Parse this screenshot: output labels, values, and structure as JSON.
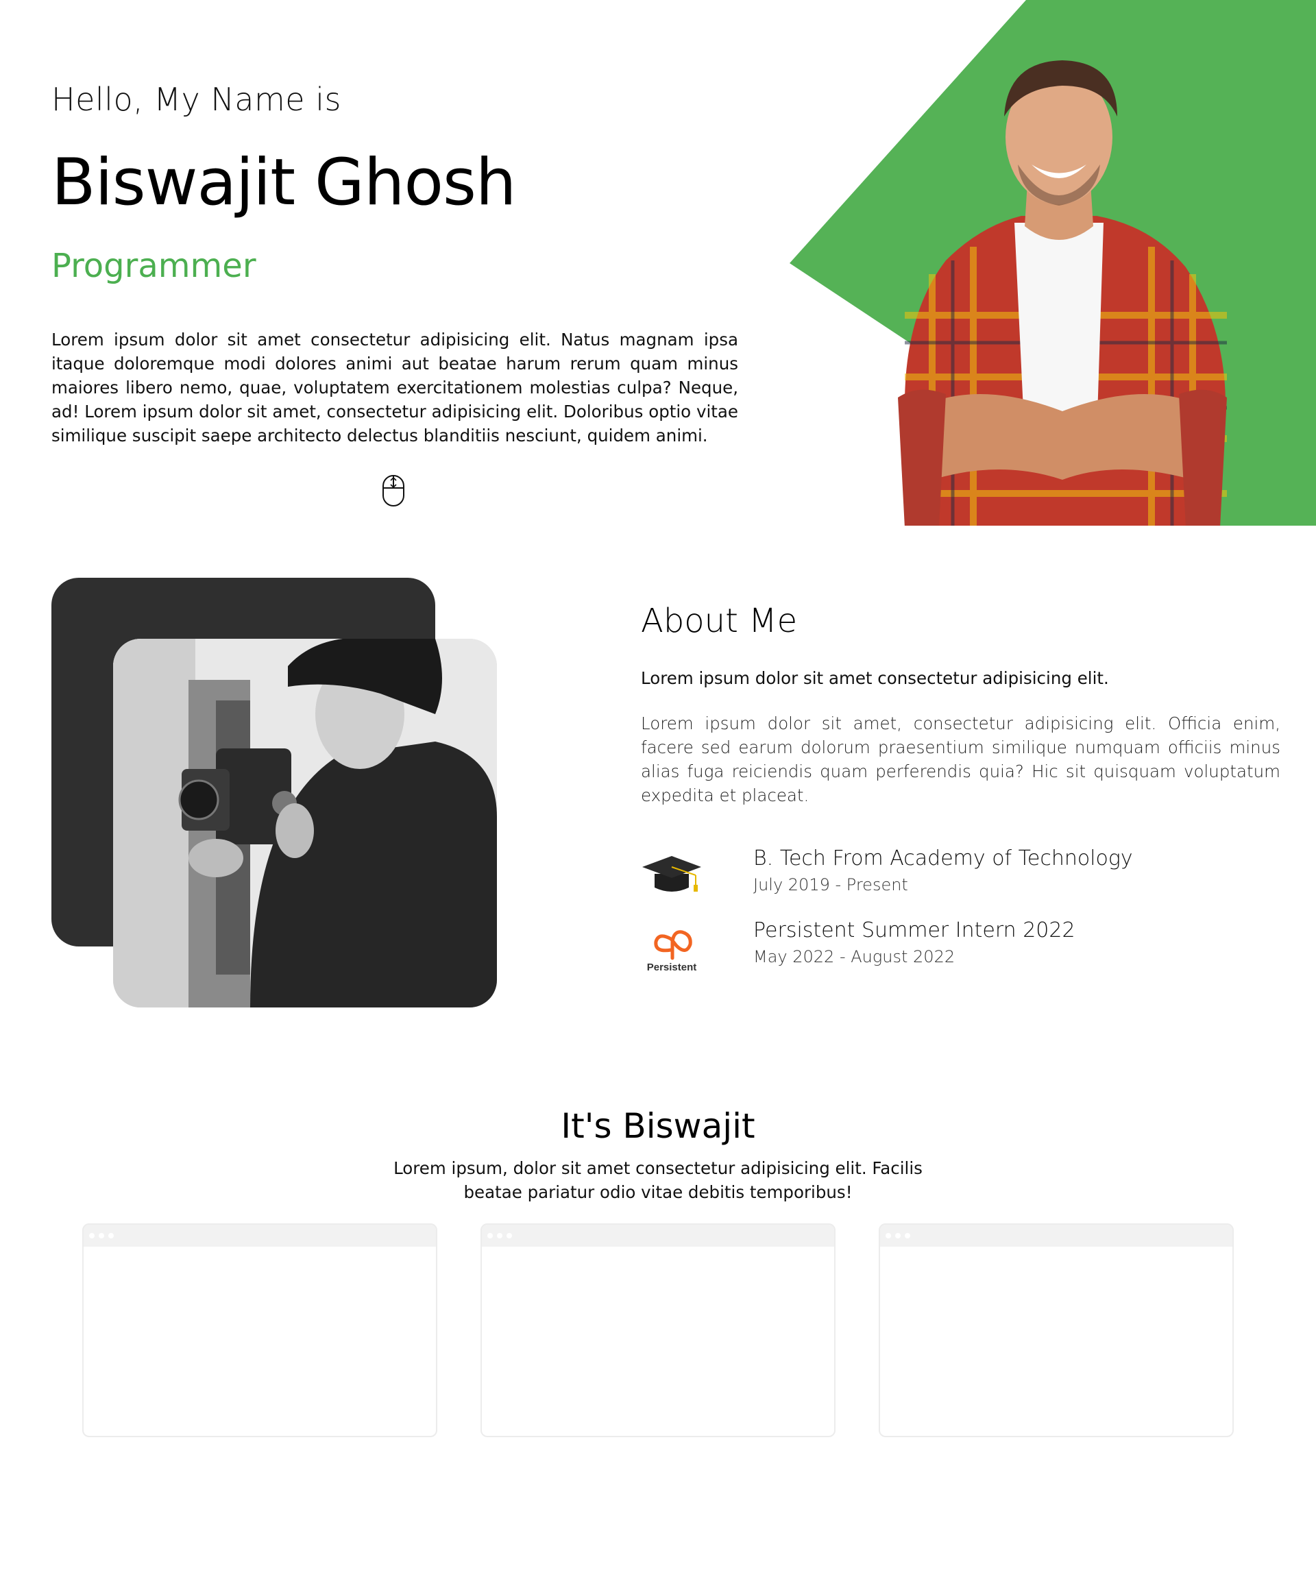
{
  "hero": {
    "greeting": "Hello, My Name is",
    "name": "Biswajit Ghosh",
    "role": "Programmer",
    "description": "Lorem ipsum dolor sit amet consectetur adipisicing elit. Natus magnam ipsa itaque doloremque modi dolores animi aut beatae harum rerum quam minus maiores libero nemo, quae, voluptatem exercitationem molestias culpa? Neque, ad! Lorem ipsum dolor sit amet, consectetur adipisicing elit. Doloribus optio vitae similique suscipit saepe architecto delectus blanditiis nesciunt, quidem animi.",
    "accent_color": "#4caf50",
    "scroll_icon": "mouse-scroll-icon"
  },
  "about": {
    "title": "About Me",
    "lead": "Lorem ipsum dolor sit amet consectetur adipisicing elit.",
    "text": "Lorem ipsum dolor sit amet, consectetur adipisicing elit. Officia enim, facere sed earum dolorum praesentium similique numquam officiis minus alias fuga reiciendis quam perferendis quia? Hic sit quisquam voluptatum expedita et placeat.",
    "experience": [
      {
        "icon": "graduation-cap-icon",
        "title": "B. Tech From Academy of Technology",
        "date": "July 2019 - Present"
      },
      {
        "icon": "persistent-logo",
        "title": "Persistent Summer Intern 2022",
        "date": "May 2022 - August 2022",
        "logo_text": "Persistent"
      }
    ]
  },
  "projects": {
    "title": "It's Biswajit",
    "text": "Lorem ipsum, dolor sit amet consectetur adipisicing elit. Facilis beatae pariatur odio vitae debitis temporibus!",
    "cards": [
      {
        "name": "project-card-1"
      },
      {
        "name": "project-card-2"
      },
      {
        "name": "project-card-3"
      }
    ]
  }
}
